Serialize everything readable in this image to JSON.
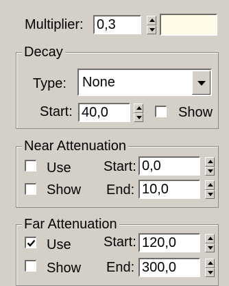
{
  "multiplier": {
    "label": "Multiplier:",
    "value": "0,3",
    "swatch_color": "#fffbe6"
  },
  "decay": {
    "title": "Decay",
    "type_label": "Type:",
    "type_value": "None",
    "start_label": "Start:",
    "start_value": "40,0",
    "show_label": "Show",
    "show_checked": false
  },
  "near": {
    "title": "Near Attenuation",
    "use_label": "Use",
    "use_checked": false,
    "show_label": "Show",
    "show_checked": false,
    "start_label": "Start:",
    "start_value": "0,0",
    "end_label": "End:",
    "end_value": "10,0"
  },
  "far": {
    "title": "Far Attenuation",
    "use_label": "Use",
    "use_checked": true,
    "show_label": "Show",
    "show_checked": false,
    "start_label": "Start:",
    "start_value": "120,0",
    "end_label": "End:",
    "end_value": "300,0"
  }
}
